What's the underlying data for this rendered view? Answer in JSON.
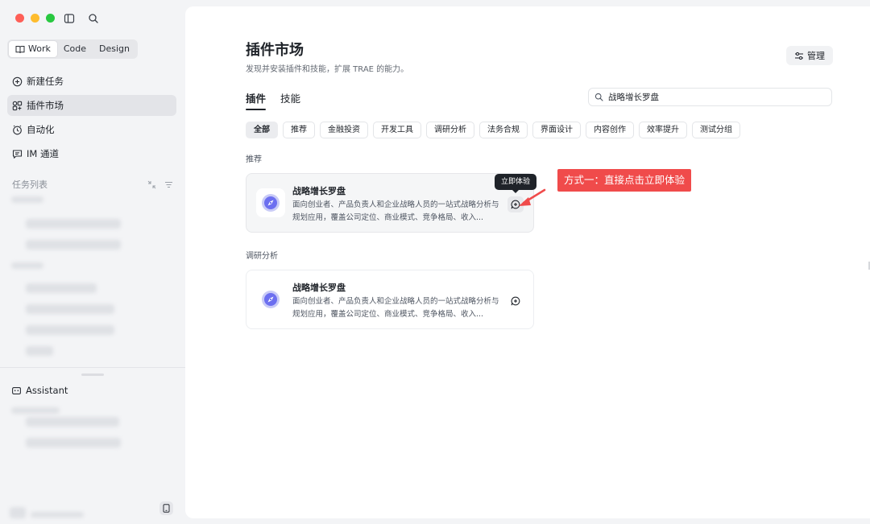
{
  "sidebar": {
    "modes": [
      {
        "label": "Work",
        "active": true
      },
      {
        "label": "Code",
        "active": false
      },
      {
        "label": "Design",
        "active": false
      }
    ],
    "nav": [
      {
        "label": "新建任务",
        "icon": "plus-circle-icon"
      },
      {
        "label": "插件市场",
        "icon": "plugin-icon",
        "active": true
      },
      {
        "label": "自动化",
        "icon": "clock-icon"
      },
      {
        "label": "IM 通道",
        "icon": "chat-icon"
      }
    ],
    "task_list_label": "任务列表",
    "assistant_label": "Assistant"
  },
  "main": {
    "title": "插件市场",
    "subtitle": "发现并安装插件和技能，扩展 TRAE 的能力。",
    "manage_label": "管理",
    "tabs": [
      {
        "label": "插件",
        "active": true
      },
      {
        "label": "技能",
        "active": false
      }
    ],
    "search": {
      "value": "战略增长罗盘"
    },
    "filters": [
      "全部",
      "推荐",
      "金融投资",
      "开发工具",
      "调研分析",
      "法务合规",
      "界面设计",
      "内容创作",
      "效率提升",
      "测试分组"
    ],
    "sections": [
      {
        "label": "推荐",
        "card": {
          "title": "战略增长罗盘",
          "description": "面向创业者、产品负责人和企业战略人员的一站式战略分析与规划应用，覆盖公司定位、商业模式、竞争格局、收入..."
        }
      },
      {
        "label": "调研分析",
        "card": {
          "title": "战略增长罗盘",
          "description": "面向创业者、产品负责人和企业战略人员的一站式战略分析与规划应用，覆盖公司定位、商业模式、竞争格局、收入..."
        }
      }
    ],
    "tooltip": "立即体验",
    "annotation": "方式一：直接点击立即体验"
  },
  "colors": {
    "annotation_bg": "#f04b4b",
    "logo_accent": "#6c6ff0",
    "tooltip_bg": "#1f2329"
  }
}
